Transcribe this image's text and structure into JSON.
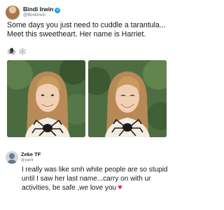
{
  "tweet1": {
    "author_name": "Bindi Irwin",
    "author_handle": "@BindiIrwin",
    "text": "Some days you just need to cuddle a tarantula...\nMeet this sweetheart. Her name is Harriet.",
    "emojis": {
      "spider": "🕷",
      "web": "🕸"
    },
    "colors": {
      "verified": "#1da1f2",
      "handle": "#657786"
    }
  },
  "tweet2": {
    "author_name": "Zeke TF",
    "author_handle": "@ygelt",
    "text": "I really was like smh white people are so stupid until I saw her last name...carry on with ur activities, be safe ,we love you",
    "heart": "♥",
    "colors": {
      "heart": "#e0245e"
    }
  }
}
